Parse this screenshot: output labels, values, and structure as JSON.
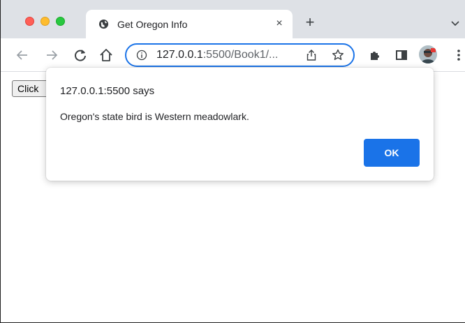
{
  "browser": {
    "tab": {
      "title": "Get Oregon Info",
      "close_glyph": "×",
      "favicon_icon": "globe-icon"
    },
    "new_tab_glyph": "+",
    "toolbar": {
      "back_icon": "arrow-left-icon",
      "forward_icon": "arrow-right-icon",
      "reload_icon": "reload-icon",
      "home_icon": "home-icon",
      "url_host": "127.0.0.1",
      "url_rest": ":5500/Book1/...",
      "info_icon": "info-icon",
      "share_icon": "share-icon",
      "bookmark_icon": "star-icon",
      "extensions_icon": "puzzle-icon",
      "sidepanel_icon": "side-panel-icon",
      "profile_icon": "avatar",
      "menu_icon": "kebab-menu-icon"
    },
    "colors": {
      "focus_ring": "#1a73e8",
      "ok_button": "#1a73e8",
      "tabstrip": "#dee1e6"
    }
  },
  "page": {
    "button_label": "Click"
  },
  "dialog": {
    "title": "127.0.0.1:5500 says",
    "message": "Oregon's state bird is Western meadowlark.",
    "ok_label": "OK"
  }
}
